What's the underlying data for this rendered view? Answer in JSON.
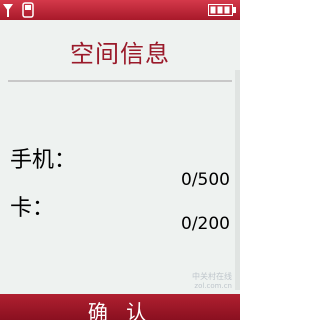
{
  "title": "空间信息",
  "rows": {
    "phone": {
      "label": "手机：",
      "value": "0/500"
    },
    "card": {
      "label": "卡：",
      "value": "0/200"
    }
  },
  "softkey": {
    "confirm_label": "确 认"
  },
  "status": {
    "signal_icon": "signal-strength-icon",
    "phone_icon": "phone-memory-icon",
    "battery_icon": "battery-icon"
  },
  "watermark": {
    "text": "中关村在线 zol.com.cn"
  },
  "colors": {
    "bar": "#b02030",
    "title": "#9a1a2a",
    "background": "#eef2f0"
  }
}
